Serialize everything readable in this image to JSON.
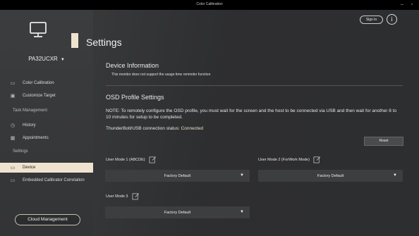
{
  "window": {
    "title": "Color Calibration",
    "minimize": "–",
    "close": "▫"
  },
  "sidebar": {
    "device": "PA32UCXR",
    "items": [
      {
        "label": "Color Calibration",
        "icon": "screen-icon"
      },
      {
        "label": "Customize Target",
        "icon": "target-icon"
      }
    ],
    "task_section": "Task Management",
    "task_items": [
      {
        "label": "History",
        "icon": "history-icon"
      },
      {
        "label": "Appointments",
        "icon": "calendar-icon"
      }
    ],
    "settings_section": "Settings",
    "settings_items": [
      {
        "label": "Device",
        "icon": "monitor-icon",
        "active": true
      },
      {
        "label": "Embedded Calibrator Correlation",
        "icon": "monitor-icon"
      }
    ],
    "cloud_button": "Cloud Management"
  },
  "header": {
    "title": "Settings",
    "signin": "Sign in",
    "info": "i"
  },
  "device_info": {
    "title": "Device Information",
    "text": "This monitor does not support the usage time reminder function"
  },
  "osd": {
    "title": "OSD Profile Settings",
    "note": "NOTE: To remotely configure the OSD profile, you must wait for the screen and the host to be connected via USB and then wait for another 8 to 10 minutes for setup to be completed.",
    "status_label": "ThunderBolt/USB connection status:",
    "status_value": "Connected",
    "reset": "Reset",
    "modes": [
      {
        "label": "User Mode 1 (ABCDE)",
        "value": "Factory Default"
      },
      {
        "label": "User Mode 2 (ForWork Mode)",
        "value": "Factory Default"
      },
      {
        "label": "User Mode 3",
        "value": "Factory Default"
      }
    ]
  },
  "colors": {
    "accent": "#efe3d0",
    "connected": "#f0e0c0",
    "background": "#2d2e30"
  }
}
